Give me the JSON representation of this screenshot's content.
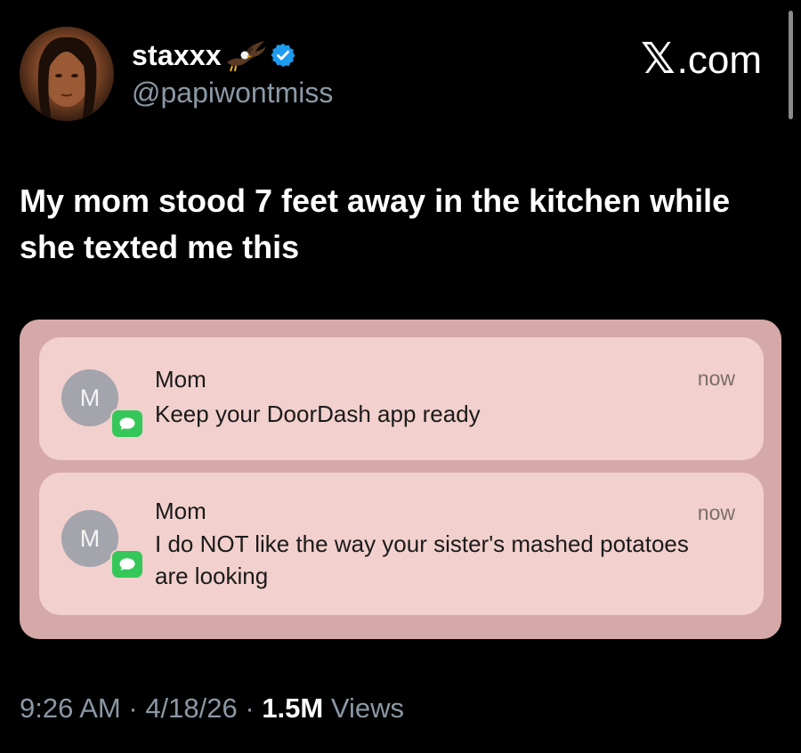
{
  "author": {
    "display_name": "staxxx",
    "handle": "@papiwontmiss",
    "verified": true,
    "accent_color": "#1d9bf0"
  },
  "site_label": {
    "glyph": "𝕏",
    "text": ".com"
  },
  "tweet": {
    "text": "My mom stood 7 feet away in the kitchen while she texted me this"
  },
  "notifications": [
    {
      "avatar_letter": "M",
      "sender": "Mom",
      "time": "now",
      "message": "Keep your DoorDash app ready",
      "app_icon": "messages-icon"
    },
    {
      "avatar_letter": "M",
      "sender": "Mom",
      "time": "now",
      "message": "I do NOT like the way your sister's mashed potatoes are looking",
      "app_icon": "messages-icon"
    }
  ],
  "meta": {
    "time": "9:26 AM",
    "date": "4/18/26",
    "separator": " · ",
    "views_count": "1.5M",
    "views_label": "Views"
  },
  "colors": {
    "background": "#000000",
    "card_background": "#d6a9a9",
    "notification_background": "#f2d0cd",
    "messages_green": "#35c759"
  }
}
